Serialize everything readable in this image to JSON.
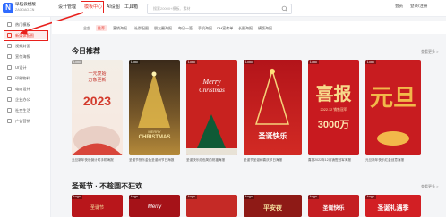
{
  "header": {
    "logo_line1": "早稻云模版",
    "logo_line2": "ZAODAO.CN",
    "logo_mark": "N",
    "nav": [
      "设计管理",
      "模板中心",
      "AI设图",
      "工具箱"
    ],
    "search_placeholder": "搜索20000+模板、素材",
    "right_items": [
      "会员",
      "登录/注册"
    ]
  },
  "sidebar": {
    "items": [
      {
        "label": "热门模板",
        "icon": "fire-icon"
      },
      {
        "label": "新媒体配图",
        "icon": "image-icon"
      },
      {
        "label": "视频封面",
        "icon": "video-icon"
      },
      {
        "label": "宣传海报",
        "icon": "poster-icon"
      },
      {
        "label": "UI设计",
        "icon": "layout-icon"
      },
      {
        "label": "印刷物料",
        "icon": "print-icon"
      },
      {
        "label": "电商设计",
        "icon": "cart-icon"
      },
      {
        "label": "企业办公",
        "icon": "office-icon"
      },
      {
        "label": "社交生活",
        "icon": "heart-icon"
      },
      {
        "label": "广告营销",
        "icon": "megaphone-icon"
      }
    ],
    "active_index": 1
  },
  "filters": [
    "全部",
    "推荐",
    "营销海报",
    "社群配图",
    "朋友圈海报",
    "每日一签",
    "手机海报",
    "DM宣传单",
    "长图海报",
    "横版海报"
  ],
  "active_filter": 1,
  "sections": [
    {
      "title": "今日推荐",
      "more": "查看更多 >"
    },
    {
      "title": "圣诞节 · 不趁圆不狂欢",
      "more": "查看更多 >"
    }
  ],
  "cards": [
    {
      "tag": "Logo",
      "caption": "元旦新年快乐倒计时手机海报",
      "poster_lines": [
        "一元复始",
        "万象更新",
        "2023"
      ]
    },
    {
      "tag": "Logo",
      "caption": "圣诞节快乐金色圣诞树节日海报",
      "poster_lines": [
        "MERRY",
        "CHRISTMAS"
      ]
    },
    {
      "tag": "Logo",
      "caption": "圣诞快乐红色简约祝福海报",
      "poster_lines": [
        "Merry",
        "Christmas"
      ]
    },
    {
      "tag": "Logo",
      "caption": "圣诞节圣诞树喜庆节日海报",
      "poster_lines": [
        "圣诞快乐"
      ]
    },
    {
      "tag": "Logo",
      "caption": "喜报2022年12月销售冠军海报",
      "poster_lines": [
        "喜报",
        "2022.12 销售冠军",
        "3000万"
      ]
    },
    {
      "tag": "Logo",
      "caption": "元旦新年快乐红金创意海报",
      "poster_lines": [
        "元旦"
      ]
    }
  ],
  "bottom_cards": [
    {
      "tag": "Logo",
      "poster_lines": [
        "圣诞节"
      ]
    },
    {
      "tag": "Logo",
      "poster_lines": [
        "Merry"
      ]
    },
    {
      "tag": "Logo",
      "poster_lines": []
    },
    {
      "tag": "Logo",
      "poster_lines": [
        "平安夜"
      ]
    },
    {
      "tag": "Logo",
      "poster_lines": [
        "圣诞快乐"
      ]
    },
    {
      "tag": "Logo",
      "poster_lines": [
        "圣诞礼遇季"
      ]
    }
  ],
  "colors": {
    "accent": "#e8382d",
    "highlight_box": "#e8201c"
  }
}
